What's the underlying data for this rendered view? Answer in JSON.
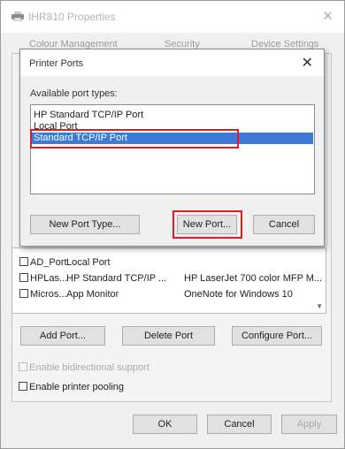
{
  "outer_window": {
    "title": "IHR810 Properties",
    "close_glyph": "✕",
    "icon": "printer-icon",
    "tabs": [
      "Colour Management",
      "Security",
      "Device Settings"
    ]
  },
  "modal": {
    "title": "Printer Ports",
    "close_glyph": "✕",
    "available_label": "Available port types:",
    "port_types": [
      "HP Standard TCP/IP Port",
      "Local Port",
      "Standard TCP/IP Port"
    ],
    "selected_index": 2,
    "buttons": {
      "new_port_type": "New Port Type...",
      "new_port": "New Port...",
      "cancel": "Cancel"
    },
    "highlight_color": "#d61f26",
    "selection_color": "#3d7ad8"
  },
  "ports_table": {
    "rows": [
      {
        "port": "AD_Port",
        "description": "Local Port",
        "printer": ""
      },
      {
        "port": "HPLas...",
        "description": "HP Standard TCP/IP ...",
        "printer": "HP LaserJet 700 color MFP M..."
      },
      {
        "port": "Micros...",
        "description": "App Monitor",
        "printer": "OneNote for Windows 10"
      }
    ]
  },
  "port_buttons": {
    "add": "Add Port...",
    "delete": "Delete Port",
    "configure": "Configure Port..."
  },
  "options": {
    "bidirectional": "Enable bidirectional support",
    "pooling": "Enable printer pooling"
  },
  "dialog_buttons": {
    "ok": "OK",
    "cancel": "Cancel",
    "apply": "Apply"
  }
}
